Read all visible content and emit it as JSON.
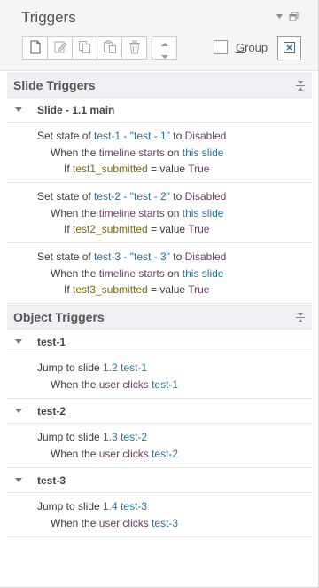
{
  "panel": {
    "title": "Triggers",
    "group_label": "Group"
  },
  "slide_triggers": {
    "header": "Slide Triggers",
    "group": "Slide - 1.1 main",
    "items": [
      {
        "l1": {
          "a": "Set state of",
          "b": "test-1 - \"test - 1\"",
          "c": "to",
          "d": "Disabled"
        },
        "l2": {
          "a": "When the",
          "b": "timeline starts",
          "c": "on",
          "d": "this slide"
        },
        "l3": {
          "a": "If",
          "b": "test1_submitted",
          "c": "= value",
          "d": "True"
        }
      },
      {
        "l1": {
          "a": "Set state of",
          "b": "test-2 - \"test - 2\"",
          "c": "to",
          "d": "Disabled"
        },
        "l2": {
          "a": "When the",
          "b": "timeline starts",
          "c": "on",
          "d": "this slide"
        },
        "l3": {
          "a": "If",
          "b": "test2_submitted",
          "c": "= value",
          "d": "True"
        }
      },
      {
        "l1": {
          "a": "Set state of",
          "b": "test-3 - \"test - 3\"",
          "c": "to",
          "d": "Disabled"
        },
        "l2": {
          "a": "When the",
          "b": "timeline starts",
          "c": "on",
          "d": "this slide"
        },
        "l3": {
          "a": "If",
          "b": "test3_submitted",
          "c": "= value",
          "d": "True"
        }
      }
    ]
  },
  "object_triggers": {
    "header": "Object Triggers",
    "groups": [
      {
        "name": "test-1",
        "l1": {
          "a": "Jump to slide",
          "b": "1.2 test-1"
        },
        "l2": {
          "a": "When the",
          "b": "user",
          "c": "clicks",
          "d": "test-1"
        }
      },
      {
        "name": "test-2",
        "l1": {
          "a": "Jump to slide",
          "b": "1.3 test-2"
        },
        "l2": {
          "a": "When the",
          "b": "user",
          "c": "clicks",
          "d": "test-2"
        }
      },
      {
        "name": "test-3",
        "l1": {
          "a": "Jump to slide",
          "b": "1.4 test-3"
        },
        "l2": {
          "a": "When the",
          "b": "user",
          "c": "clicks",
          "d": "test-3"
        }
      }
    ]
  },
  "icons": {
    "toolbar": [
      "new-trigger-icon",
      "edit-trigger-icon",
      "copy-icon",
      "paste-icon",
      "delete-icon",
      "move-up-icon",
      "move-down-icon"
    ],
    "header": [
      "pin-icon",
      "restore-window-icon"
    ],
    "close": "close-panel-icon",
    "collapse": "collapse-all-icon"
  },
  "colors": {
    "link_blue": "#2a6f9e",
    "state_purple": "#6a3e63",
    "variable_olive": "#7a6a12",
    "section_bg": "#eef0f3"
  }
}
